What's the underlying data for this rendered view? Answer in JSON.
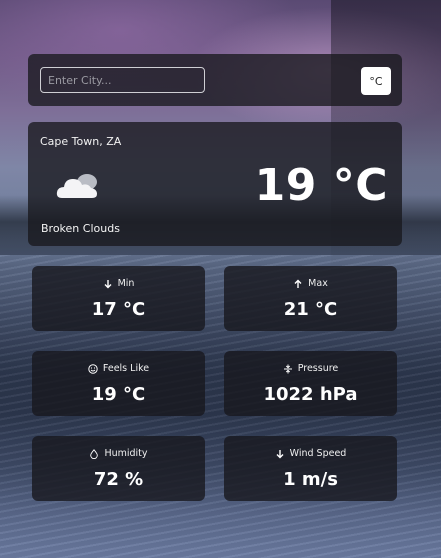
{
  "search": {
    "placeholder": "Enter City...",
    "value": ""
  },
  "unit_toggle": {
    "label": "°C"
  },
  "current": {
    "location": "Cape Town, ZA",
    "condition": "Broken Clouds",
    "temperature": "19 °C",
    "icon": "cloud-icon"
  },
  "stats": {
    "min": {
      "label": "Min",
      "value": "17 °C",
      "icon": "arrow-down-icon"
    },
    "max": {
      "label": "Max",
      "value": "21 °C",
      "icon": "arrow-up-icon"
    },
    "feels_like": {
      "label": "Feels Like",
      "value": "19 °C",
      "icon": "smiley-icon"
    },
    "pressure": {
      "label": "Pressure",
      "value": "1022 hPa",
      "icon": "compress-icon"
    },
    "humidity": {
      "label": "Humidity",
      "value": "72 %",
      "icon": "droplet-icon"
    },
    "wind_speed": {
      "label": "Wind Speed",
      "value": "1 m/s",
      "icon": "arrow-down-icon"
    }
  }
}
